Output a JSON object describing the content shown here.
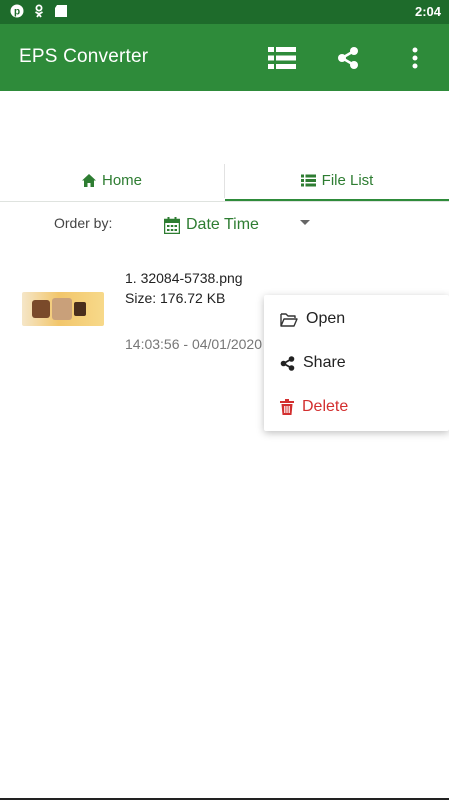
{
  "status_bar": {
    "time": "2:04",
    "icons": [
      "pinterest-icon",
      "odnoklassniki-icon",
      "android-icon"
    ]
  },
  "app_bar": {
    "title": "EPS Converter",
    "actions": [
      "list-icon",
      "share-icon",
      "more-vert-icon"
    ]
  },
  "tabs": [
    {
      "label": "Home",
      "icon": "home-icon",
      "selected": false
    },
    {
      "label": "File List",
      "icon": "list-icon",
      "selected": true
    }
  ],
  "order": {
    "label": "Order by:",
    "selected_value": "Date Time",
    "icon": "calendar-icon"
  },
  "files": [
    {
      "name": "1. 32084-5738.png",
      "size": "Size: 176.72 KB",
      "time": "14:03:56 - 04/01/2020"
    }
  ],
  "context_menu": {
    "items": [
      {
        "label": "Open",
        "icon": "folder-open-icon"
      },
      {
        "label": "Share",
        "icon": "share-icon"
      },
      {
        "label": "Delete",
        "icon": "trash-icon",
        "color": "#d32f2f"
      }
    ]
  },
  "colors": {
    "primary": "#2e8b3a",
    "status_bar": "#1e6b2b",
    "accent_text": "#2e7d32",
    "danger": "#d32f2f"
  }
}
